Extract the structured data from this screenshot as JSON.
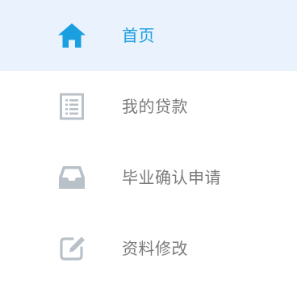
{
  "colors": {
    "active_background": "#e9f2fd",
    "active_accent": "#1a9fe0",
    "inactive_icon": "#b9c1c8",
    "inactive_text": "#7b7b7b"
  },
  "menu": {
    "items": [
      {
        "label": "首页",
        "icon": "home-icon",
        "active": true
      },
      {
        "label": "我的贷款",
        "icon": "list-document-icon",
        "active": false
      },
      {
        "label": "毕业确认申请",
        "icon": "inbox-tray-icon",
        "active": false
      },
      {
        "label": "资料修改",
        "icon": "edit-icon",
        "active": false
      }
    ]
  }
}
